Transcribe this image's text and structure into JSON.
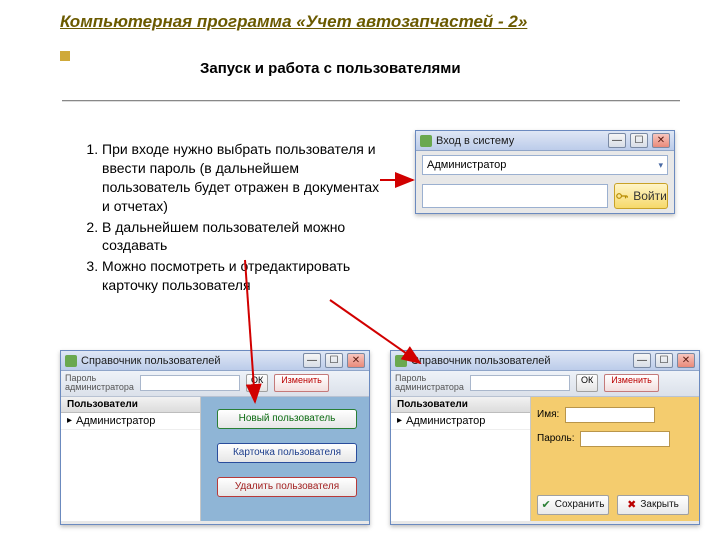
{
  "title": "Компьютерная программа «Учет автозапчастей - 2»",
  "subtitle": "Запуск и работа с пользователями",
  "instructions": [
    "При входе нужно выбрать пользователя и ввести пароль (в дальнейшем пользователь будет отражен в документах и отчетах)",
    "В дальнейшем пользователей можно создавать",
    "Можно посмотреть и отредактировать карточку пользователя"
  ],
  "login": {
    "title": "Вход в систему",
    "selected_user": "Администратор",
    "password_placeholder": "",
    "enter": "Войти"
  },
  "dir": {
    "title": "Справочник пользователей",
    "pw_label_line1": "Пароль",
    "pw_label_line2": "администратора",
    "ok": "ОК",
    "modify": "Изменить",
    "list_header": "Пользователи",
    "list_item": "Администратор",
    "btn_new": "Новый пользователь",
    "btn_card": "Карточка пользователя",
    "btn_del": "Удалить пользователя",
    "form": {
      "name_label": "Имя:",
      "pass_label": "Пароль:"
    },
    "save": "Сохранить",
    "close": "Закрыть"
  }
}
